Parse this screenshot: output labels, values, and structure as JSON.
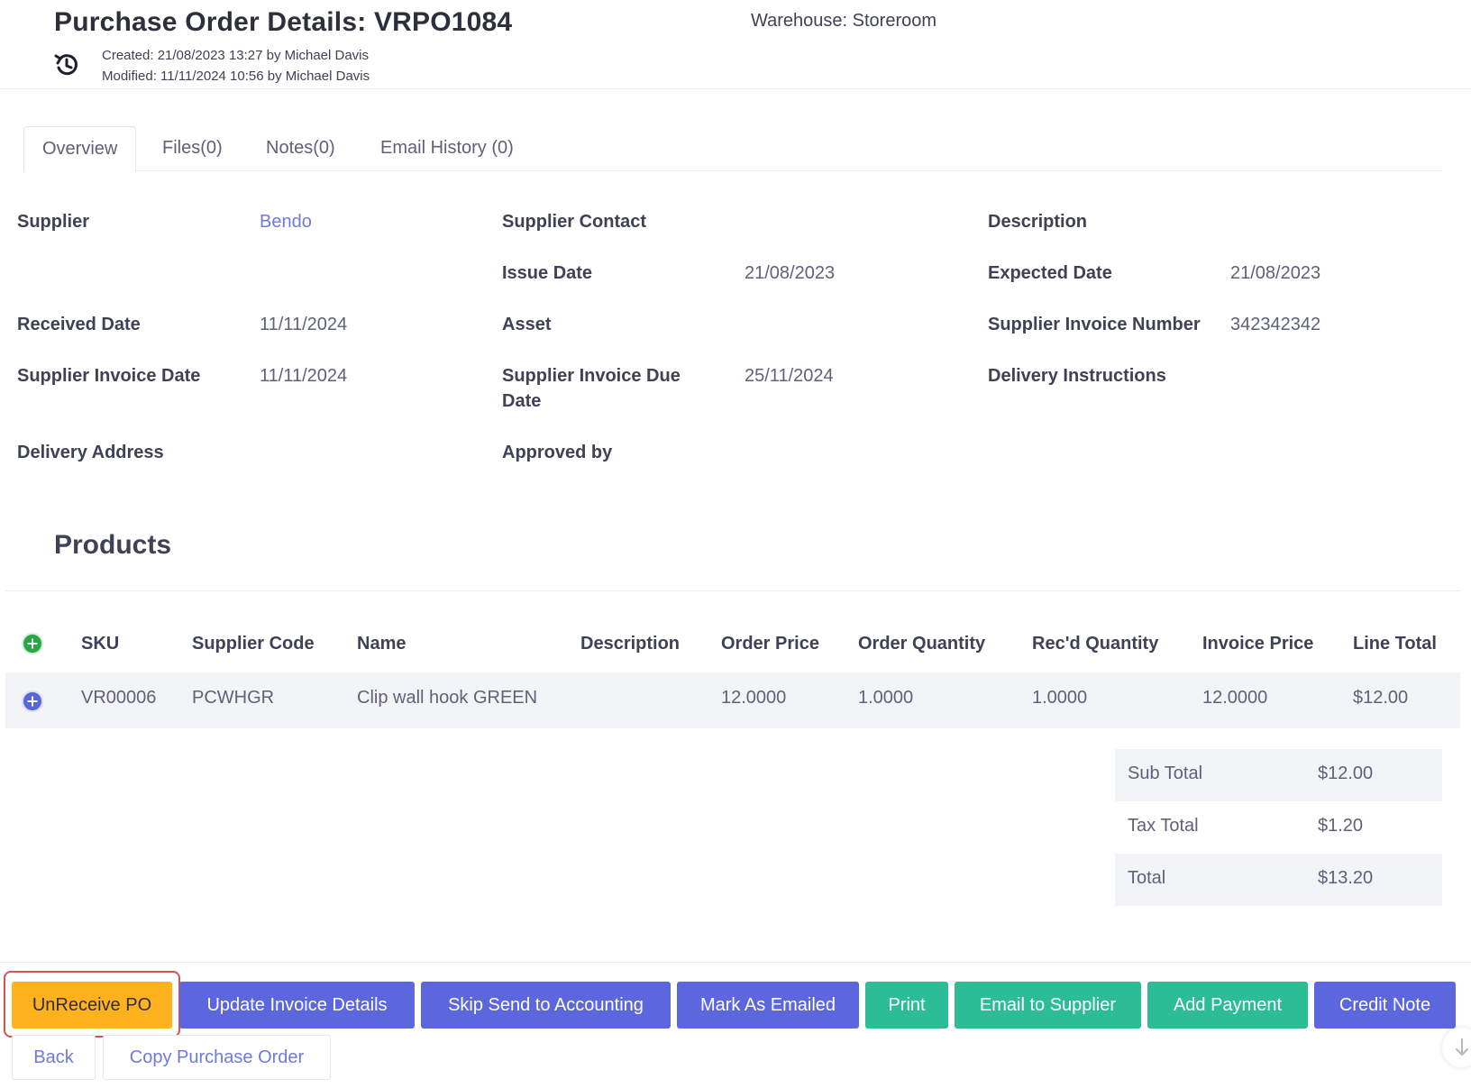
{
  "header": {
    "title": "Purchase Order Details: VRPO1084",
    "created": "Created: 21/08/2023 13:27 by Michael Davis",
    "modified": "Modified: 11/11/2024 10:56 by Michael Davis",
    "warehouse": "Warehouse: Storeroom",
    "history_icon": "history-icon"
  },
  "tabs": [
    {
      "label": "Overview",
      "active": true
    },
    {
      "label": "Files(0)",
      "active": false
    },
    {
      "label": "Notes(0)",
      "active": false
    },
    {
      "label": "Email History (0)",
      "active": false
    }
  ],
  "details": {
    "supplier_label": "Supplier",
    "supplier_value": "Bendo",
    "supplier_contact_label": "Supplier Contact",
    "description_label": "Description",
    "issue_date_label": "Issue Date",
    "issue_date_value": "21/08/2023",
    "expected_date_label": "Expected Date",
    "expected_date_value": "21/08/2023",
    "received_date_label": "Received Date",
    "received_date_value": "11/11/2024",
    "asset_label": "Asset",
    "supplier_invoice_number_label": "Supplier Invoice Number",
    "supplier_invoice_number_value": "342342342",
    "supplier_invoice_date_label": "Supplier Invoice Date",
    "supplier_invoice_date_value": "11/11/2024",
    "supplier_invoice_due_label_1": "Supplier Invoice Due",
    "supplier_invoice_due_label_2": "Date",
    "supplier_invoice_due_value": "25/11/2024",
    "delivery_instructions_label": "Delivery Instructions",
    "delivery_address_label": "Delivery Address",
    "approved_by_label": "Approved by"
  },
  "products": {
    "title": "Products",
    "columns": [
      "SKU",
      "Supplier Code",
      "Name",
      "Description",
      "Order Price",
      "Order Quantity",
      "Rec'd Quantity",
      "Invoice Price",
      "Line Total"
    ],
    "rows": [
      {
        "sku": "VR00006",
        "supplier_code": "PCWHGR",
        "name": "Clip wall hook GREEN",
        "description": "",
        "order_price": "12.0000",
        "order_quantity": "1.0000",
        "recd_quantity": "1.0000",
        "invoice_price": "12.0000",
        "line_total": "$12.00"
      }
    ]
  },
  "totals": {
    "sub_total_label": "Sub Total",
    "sub_total_value": "$12.00",
    "tax_total_label": "Tax Total",
    "tax_total_value": "$1.20",
    "total_label": "Total",
    "total_value": "$13.20"
  },
  "actions": {
    "unreceive": "UnReceive PO",
    "update_invoice": "Update Invoice Details",
    "skip_accounting": "Skip Send to Accounting",
    "mark_emailed": "Mark As Emailed",
    "print": "Print",
    "email_supplier": "Email to Supplier",
    "add_payment": "Add Payment",
    "credit_note": "Credit Note",
    "back": "Back",
    "copy_po": "Copy Purchase Order"
  },
  "colors": {
    "accent_purple": "#5c67dd",
    "accent_teal": "#2dbd96",
    "accent_orange": "#ffb21e",
    "link": "#6f7ae0",
    "highlight": "#d9534f"
  }
}
